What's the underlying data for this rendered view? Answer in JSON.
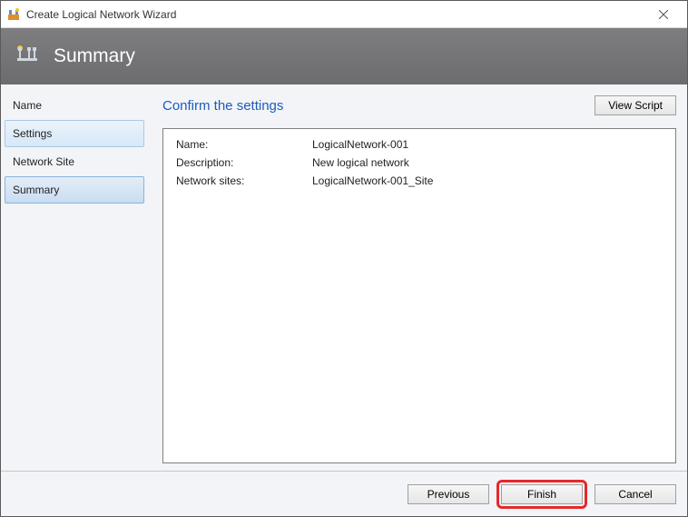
{
  "titlebar": {
    "title": "Create Logical Network Wizard"
  },
  "banner": {
    "title": "Summary"
  },
  "sidebar": {
    "items": [
      {
        "label": "Name",
        "state": "normal"
      },
      {
        "label": "Settings",
        "state": "highlight"
      },
      {
        "label": "Network Site",
        "state": "normal"
      },
      {
        "label": "Summary",
        "state": "selected"
      }
    ]
  },
  "main": {
    "heading": "Confirm the settings",
    "view_script_label": "View Script",
    "rows": [
      {
        "label": "Name:",
        "value": "LogicalNetwork-001"
      },
      {
        "label": "Description:",
        "value": "New logical network"
      },
      {
        "label": "Network sites:",
        "value": "LogicalNetwork-001_Site"
      }
    ]
  },
  "footer": {
    "previous_label": "Previous",
    "finish_label": "Finish",
    "cancel_label": "Cancel"
  }
}
